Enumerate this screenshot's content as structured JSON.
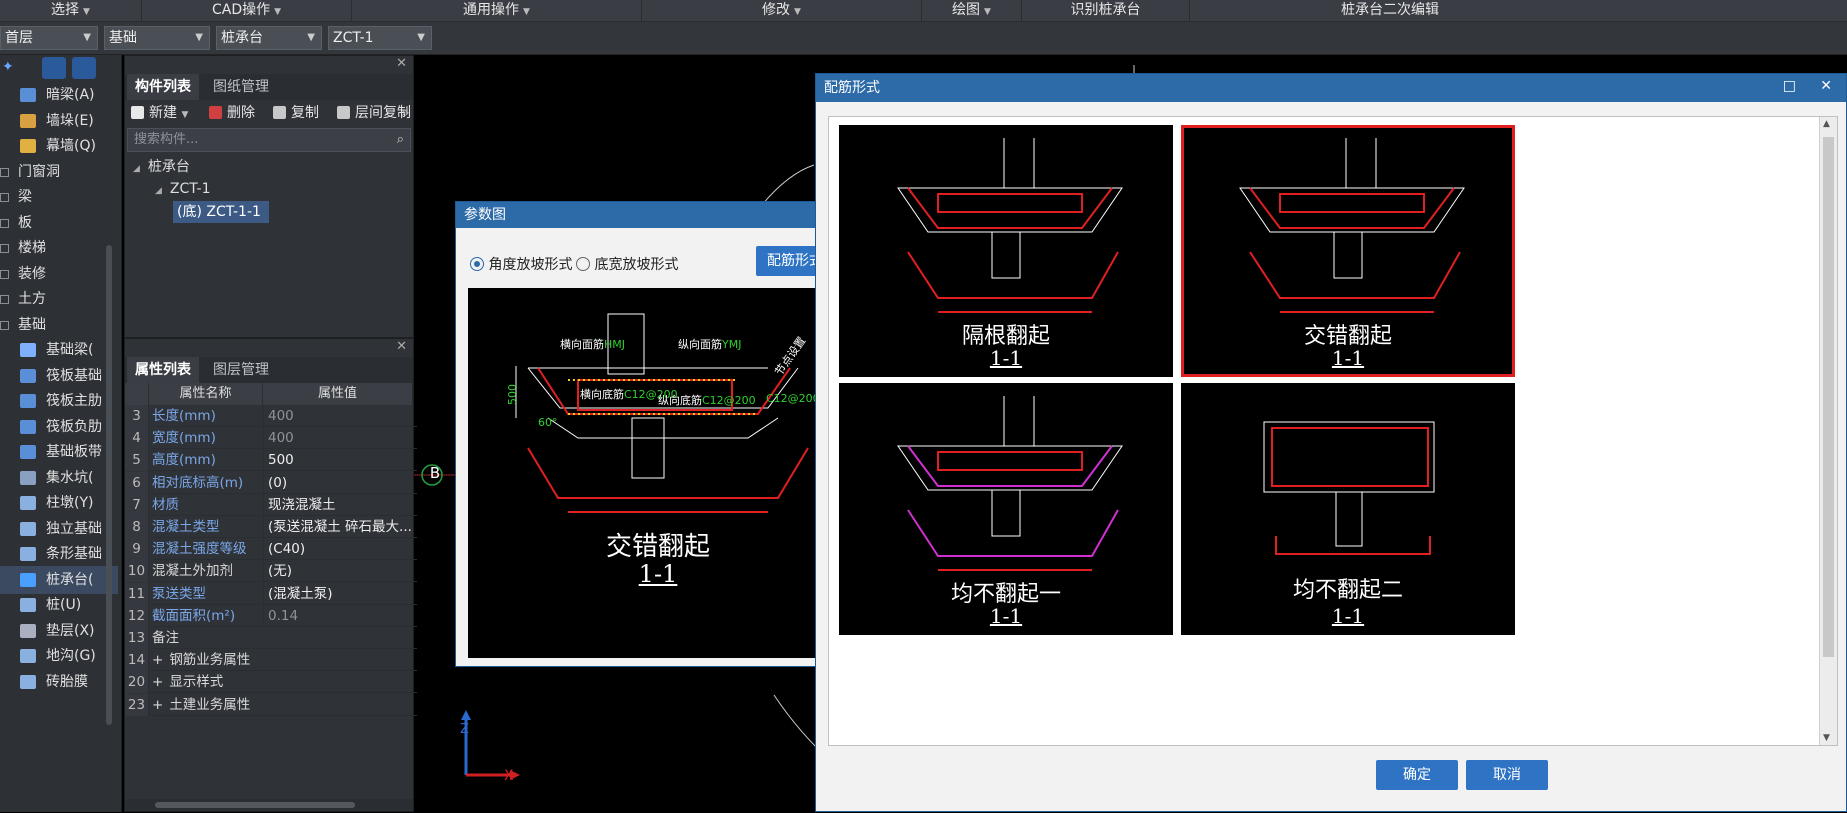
{
  "ribbon": {
    "items": [
      {
        "label": "选择",
        "caret": true
      },
      {
        "label": "CAD操作",
        "caret": true
      },
      {
        "label": "通用操作",
        "caret": true
      },
      {
        "label": "修改",
        "caret": true
      },
      {
        "label": "绘图",
        "caret": true
      },
      {
        "label": "识别桩承台",
        "caret": false
      },
      {
        "label": "桩承台二次编辑",
        "caret": false
      }
    ]
  },
  "dropbar": {
    "floor": "首层",
    "category": "基础",
    "type": "桩承台",
    "component": "ZCT-1"
  },
  "leftrail": {
    "items": [
      {
        "label": "暗梁(A)",
        "kind": "item",
        "color": "#5a8fd8"
      },
      {
        "label": "墙垛(E)",
        "kind": "item",
        "color": "#d8a040"
      },
      {
        "label": "幕墙(Q)",
        "kind": "item",
        "color": "#e0b040"
      },
      {
        "label": "门窗洞",
        "kind": "group"
      },
      {
        "label": "梁",
        "kind": "group"
      },
      {
        "label": "板",
        "kind": "group"
      },
      {
        "label": "楼梯",
        "kind": "group"
      },
      {
        "label": "装修",
        "kind": "group"
      },
      {
        "label": "土方",
        "kind": "group"
      },
      {
        "label": "基础",
        "kind": "group-open"
      },
      {
        "label": "基础梁(",
        "kind": "item",
        "color": "#7fb0ff"
      },
      {
        "label": "筏板基础",
        "kind": "item",
        "color": "#5a8fd8"
      },
      {
        "label": "筏板主肋",
        "kind": "item",
        "color": "#5a8fd8"
      },
      {
        "label": "筏板负肋",
        "kind": "item",
        "color": "#5a8fd8"
      },
      {
        "label": "基础板带",
        "kind": "item",
        "color": "#5a8fd8"
      },
      {
        "label": "集水坑(",
        "kind": "item",
        "color": "#8aa0c0"
      },
      {
        "label": "柱墩(Y)",
        "kind": "item",
        "color": "#8ab0e0"
      },
      {
        "label": "独立基础",
        "kind": "item",
        "color": "#8ab0e0"
      },
      {
        "label": "条形基础",
        "kind": "item",
        "color": "#8ab0e0"
      },
      {
        "label": "桩承台(",
        "kind": "item-selected",
        "color": "#4aa0ff"
      },
      {
        "label": "桩(U)",
        "kind": "item",
        "color": "#8ab0e0"
      },
      {
        "label": "垫层(X)",
        "kind": "item",
        "color": "#aab0c0"
      },
      {
        "label": "地沟(G)",
        "kind": "item",
        "color": "#8ab0e0"
      },
      {
        "label": "砖胎膜",
        "kind": "item",
        "color": "#8ab0e0"
      }
    ]
  },
  "component_panel": {
    "tabs": [
      "构件列表",
      "图纸管理"
    ],
    "toolbar": {
      "new": "新建",
      "delete": "删除",
      "copy": "复制",
      "floor_copy": "层间复制",
      "more": "»"
    },
    "search_placeholder": "搜索构件...",
    "tree": {
      "root": "桩承台",
      "child": "ZCT-1",
      "leaf": "(底) ZCT-1-1"
    }
  },
  "property_panel": {
    "tabs": [
      "属性列表",
      "图层管理"
    ],
    "headers": {
      "name": "属性名称",
      "value": "属性值"
    },
    "rows": [
      {
        "num": "3",
        "name": "长度(mm)",
        "value": "400",
        "name_style": "blue",
        "value_style": "grey",
        "expand": false
      },
      {
        "num": "4",
        "name": "宽度(mm)",
        "value": "400",
        "name_style": "blue",
        "value_style": "grey",
        "expand": false
      },
      {
        "num": "5",
        "name": "高度(mm)",
        "value": "500",
        "name_style": "blue",
        "value_style": "",
        "expand": false
      },
      {
        "num": "6",
        "name": "相对底标高(m)",
        "value": "(0)",
        "name_style": "blue",
        "value_style": "",
        "expand": false
      },
      {
        "num": "7",
        "name": "材质",
        "value": "现浇混凝土",
        "name_style": "blue",
        "value_style": "",
        "expand": false
      },
      {
        "num": "8",
        "name": "混凝土类型",
        "value": "(泵送混凝土 碎石最大...",
        "name_style": "blue",
        "value_style": "",
        "expand": false
      },
      {
        "num": "9",
        "name": "混凝土强度等级",
        "value": "(C40)",
        "name_style": "blue",
        "value_style": "",
        "expand": false
      },
      {
        "num": "10",
        "name": "混凝土外加剂",
        "value": "(无)",
        "name_style": "",
        "value_style": "",
        "expand": false
      },
      {
        "num": "11",
        "name": "泵送类型",
        "value": "(混凝土泵)",
        "name_style": "blue",
        "value_style": "",
        "expand": false
      },
      {
        "num": "12",
        "name": "截面面积(m²)",
        "value": "0.14",
        "name_style": "blue",
        "value_style": "grey",
        "expand": false
      },
      {
        "num": "13",
        "name": "备注",
        "value": "",
        "name_style": "",
        "value_style": "",
        "expand": false
      },
      {
        "num": "14",
        "name": "钢筋业务属性",
        "value": "",
        "name_style": "",
        "value_style": "",
        "expand": true
      },
      {
        "num": "20",
        "name": "显示样式",
        "value": "",
        "name_style": "",
        "value_style": "",
        "expand": true
      },
      {
        "num": "23",
        "name": "土建业务属性",
        "value": "",
        "name_style": "",
        "value_style": "",
        "expand": true
      }
    ]
  },
  "param_dialog": {
    "title": "参数图",
    "radio_angle": "角度放坡形式",
    "radio_width": "底宽放坡形式",
    "rebar_button": "配筋形式",
    "caption": "交错翻起",
    "section": "1-1",
    "labels": {
      "top_h": "横向面筋",
      "top_h_code": "HMJ",
      "top_v": "纵向面筋",
      "top_v_code": "YMJ",
      "bot_h": "横向底筋",
      "bot_v": "纵向底筋",
      "spacing1": "C12@200",
      "spacing2": "C12@200",
      "spacing3": "C12@200",
      "slope": "节点设置",
      "height": "500",
      "angle": "60°"
    }
  },
  "rebar_dialog": {
    "title": "配筋形式",
    "options": [
      {
        "caption": "隔根翻起",
        "section": "1-1",
        "selected": false
      },
      {
        "caption": "交错翻起",
        "section": "1-1",
        "selected": true
      },
      {
        "caption": "均不翻起一",
        "section": "1-1",
        "selected": false
      },
      {
        "caption": "均不翻起二",
        "section": "1-1",
        "selected": false
      }
    ],
    "ok": "确定",
    "cancel": "取消",
    "window_icons": {
      "maximize": "□",
      "close": "✕"
    }
  },
  "canvas": {
    "axis_marker": "B",
    "axis_x": "X",
    "axis_z": "Z"
  },
  "colors": {
    "accent": "#2c6aa8",
    "selected_border": "#e02020",
    "rebar_red": "#e02020",
    "rebar_yellow": "#f0d020",
    "text_green": "#30d030",
    "magenta": "#d030d0"
  }
}
